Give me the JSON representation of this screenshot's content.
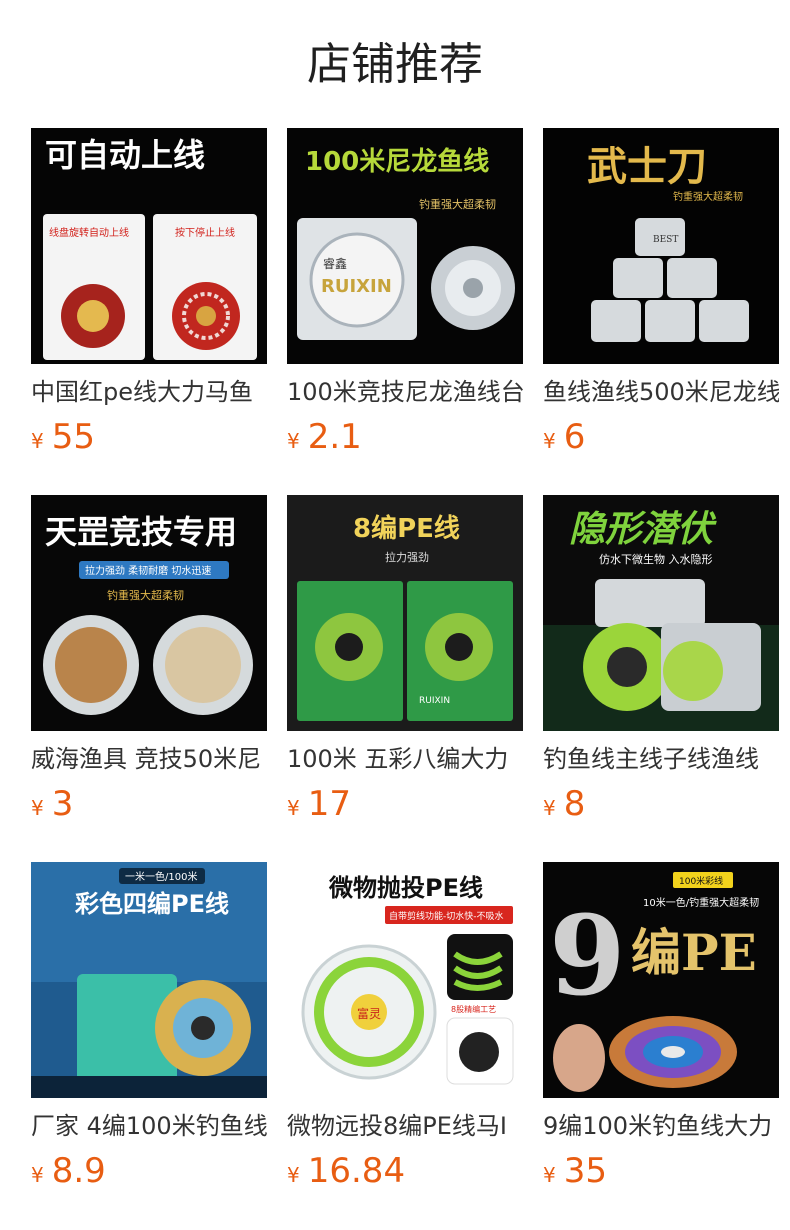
{
  "title": "店铺推荐",
  "currency": "¥",
  "products": [
    {
      "name": "中国红pe线大力马鱼",
      "price": "55",
      "image_text": [
        "可自动上线",
        "线盘旋转自动上线",
        "按下停止上线"
      ]
    },
    {
      "name": "100米竞技尼龙渔线台",
      "price": "2.1",
      "image_text": [
        "100米尼龙鱼线",
        "钓重强大超柔韧",
        "RUIXIN",
        "睿鑫"
      ]
    },
    {
      "name": "鱼线渔线500米尼龙线",
      "price": "6",
      "image_text": [
        "武士刀",
        "钓重强大超柔韧",
        "BEST"
      ]
    },
    {
      "name": "威海渔具 竞技50米尼",
      "price": "3",
      "image_text": [
        "天罡竞技专用",
        "拉力强劲 柔韧耐磨 切水迅速",
        "钓重强大超柔韧"
      ]
    },
    {
      "name": "100米 五彩八编大力",
      "price": "17",
      "image_text": [
        "8编PE线",
        "拉力强劲",
        "RUIXIN"
      ]
    },
    {
      "name": "钓鱼线主线子线渔线",
      "price": "8",
      "image_text": [
        "隐形潜伏",
        "仿水下微生物 入水隐形"
      ]
    },
    {
      "name": "厂家 4编100米钓鱼线",
      "price": "8.9",
      "image_text": [
        "一米一色/100米",
        "彩色四编PE线"
      ]
    },
    {
      "name": "微物远投8编PE线马I",
      "price": "16.84",
      "image_text": [
        "微物抛投PE线",
        "自带剪线功能-切水快-不吸水",
        "富灵",
        "8股精编工艺"
      ]
    },
    {
      "name": "9编100米钓鱼线大力",
      "price": "35",
      "image_text": [
        "100米彩线",
        "10米一色/钓重强大超柔韧",
        "9",
        "编PE"
      ]
    }
  ],
  "colors": {
    "price": "#e85d12",
    "name": "#333333",
    "title": "#1f1f1f"
  }
}
